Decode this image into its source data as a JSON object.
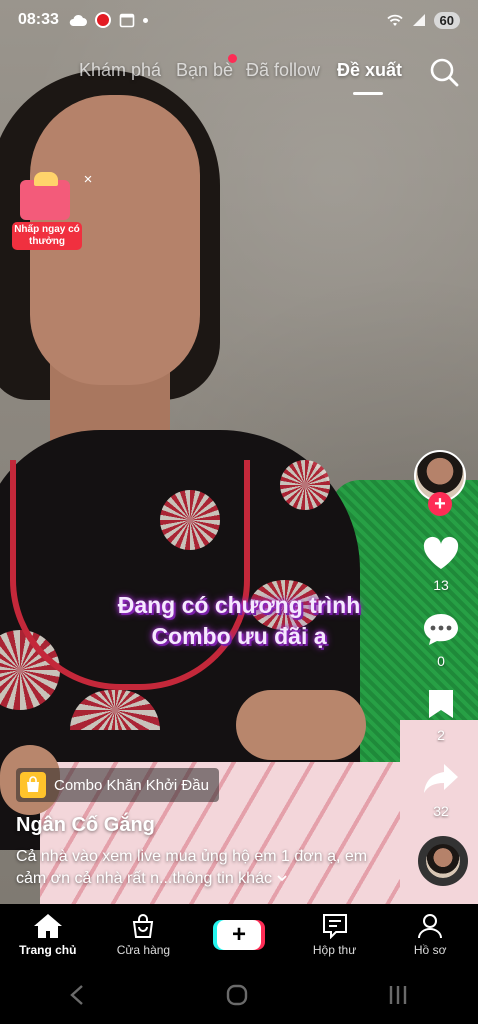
{
  "status_bar": {
    "time": "08:33",
    "battery": "60"
  },
  "top_nav": {
    "tabs": [
      {
        "label": "Khám phá"
      },
      {
        "label": "Bạn bè"
      },
      {
        "label": "Đã follow"
      },
      {
        "label": "Đề xuất"
      }
    ],
    "active_tab": "Đề xuất"
  },
  "promo": {
    "label": "Nhấp ngay có thưởng"
  },
  "video": {
    "caption_line1": "Đang có chương trình",
    "caption_line2": "Combo ưu đãi ạ"
  },
  "side_rail": {
    "likes": "13",
    "comments": "0",
    "saves": "2",
    "shares": "32"
  },
  "post": {
    "shop_label": "Combo Khăn Khởi Đầu",
    "author": "Ngân Cố Gắng",
    "description": "Cả nhà vào xem live mua ủng hộ em 1 đơn ạ, em cảm ơn cả nhà rất n...",
    "more_label": "thông tin khác"
  },
  "bottom_nav": {
    "items": [
      {
        "label": "Trang chủ"
      },
      {
        "label": "Cửa hàng"
      },
      {
        "label": "Hộp thư"
      },
      {
        "label": "Hồ sơ"
      }
    ]
  },
  "colors": {
    "accent_red": "#fe2c55",
    "accent_cyan": "#25f4ee",
    "caption_glow": "#9b2ec7"
  }
}
